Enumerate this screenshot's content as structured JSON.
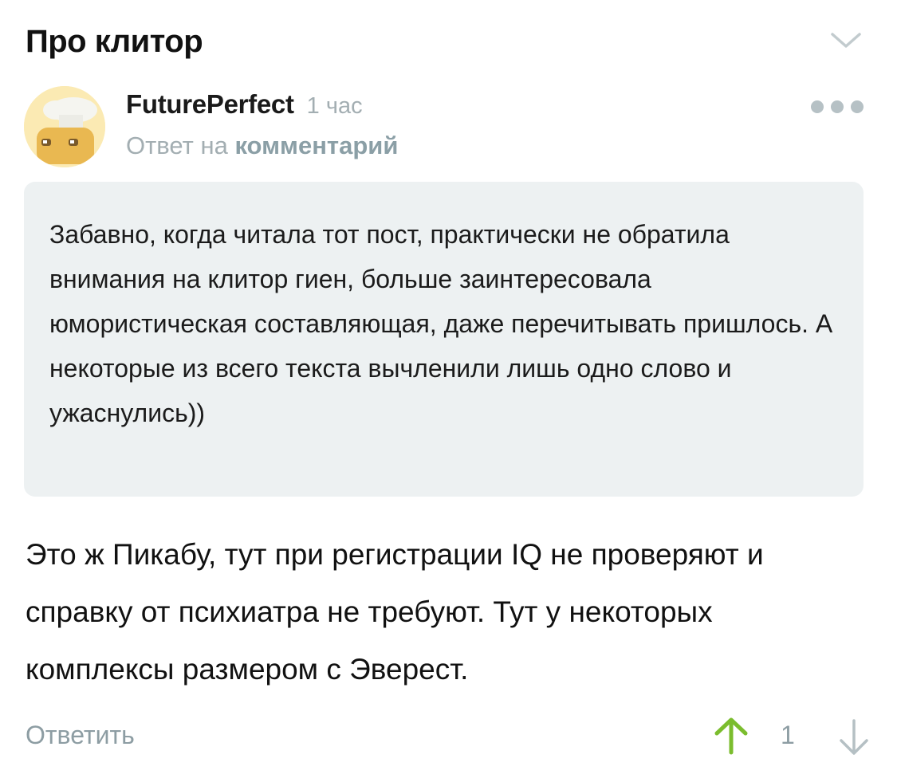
{
  "post": {
    "title": "Про клитор"
  },
  "comment": {
    "author": "FuturePerfect",
    "time": "1 час",
    "reply_prefix": "Ответ на",
    "reply_link": "комментарий",
    "quote": "Забавно, когда читала тот пост, практически не обратила внимания на клитор гиен, больше заинтересовала юмористическая составляющая, даже перечитывать пришлось. А некоторые из всего текста вычленили лишь одно слово и ужаснулись))",
    "body": "Это ж Пикабу, тут при регистрации IQ не проверяют и справку от психиатра не требуют. Тут у некоторых комплексы размером с Эверест."
  },
  "actions": {
    "reply_label": "Ответить",
    "rating": "1"
  },
  "icons": {
    "collapse": "chevron-down-icon",
    "more": "more-dots-icon",
    "upvote": "arrow-up-icon",
    "downvote": "arrow-down-icon"
  },
  "colors": {
    "upvote": "#7bbd2e",
    "muted": "#a3aeb2",
    "quote_bg": "#edf1f2"
  }
}
